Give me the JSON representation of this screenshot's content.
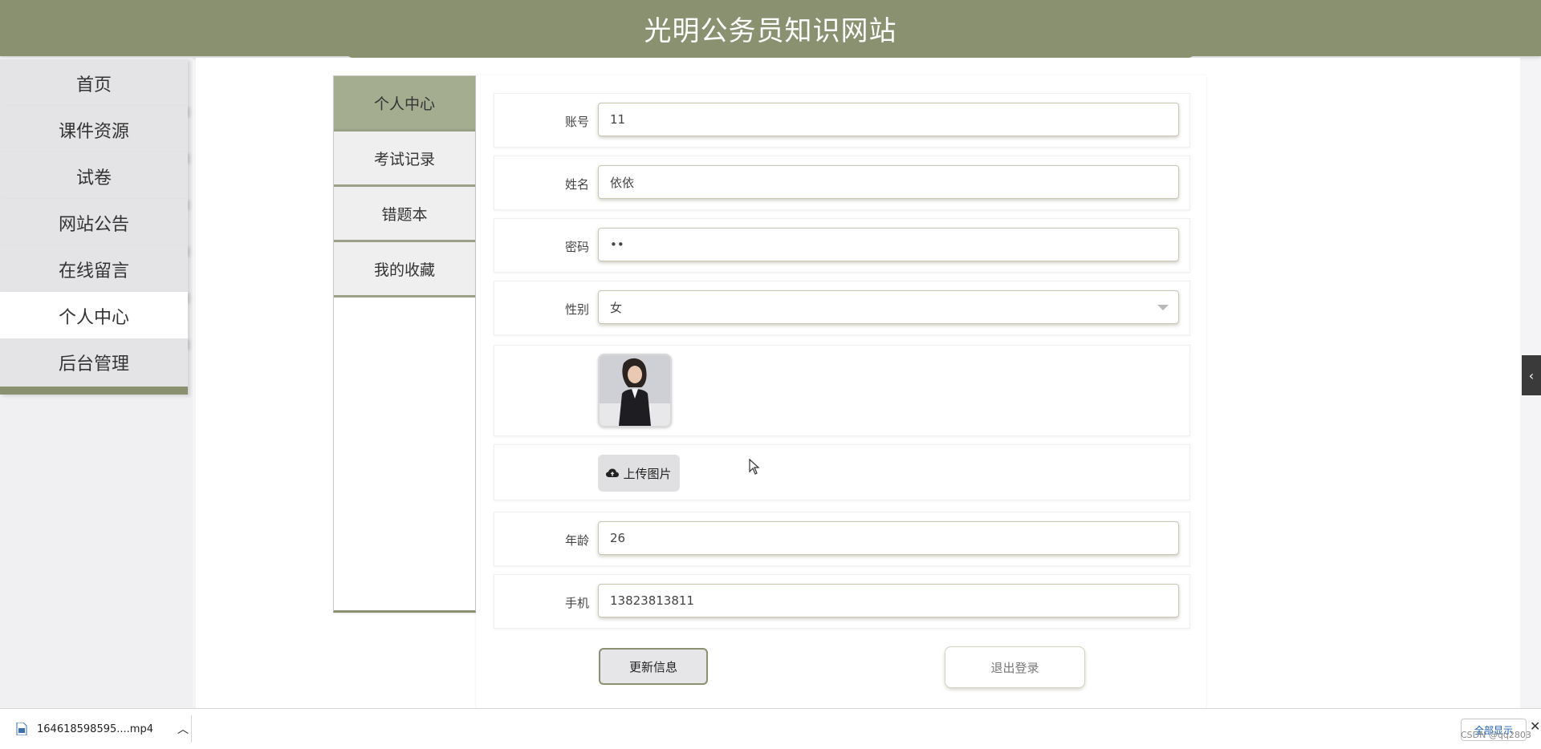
{
  "header": {
    "title": "光明公务员知识网站"
  },
  "nav": {
    "items": [
      {
        "label": "首页"
      },
      {
        "label": "课件资源"
      },
      {
        "label": "试卷"
      },
      {
        "label": "网站公告"
      },
      {
        "label": "在线留言"
      },
      {
        "label": "个人中心",
        "active": true
      },
      {
        "label": "后台管理"
      }
    ]
  },
  "subnav": {
    "items": [
      {
        "label": "个人中心",
        "active": true
      },
      {
        "label": "考试记录"
      },
      {
        "label": "错题本"
      },
      {
        "label": "我的收藏"
      }
    ]
  },
  "form": {
    "account": {
      "label": "账号",
      "value": "11"
    },
    "name": {
      "label": "姓名",
      "value": "依依"
    },
    "password": {
      "label": "密码",
      "value": "11"
    },
    "gender": {
      "label": "性别",
      "value": "女"
    },
    "upload_label": "上传图片",
    "age": {
      "label": "年龄",
      "value": "26"
    },
    "phone": {
      "label": "手机",
      "value": "13823813811"
    },
    "update_button": "更新信息",
    "logout_button": "退出登录"
  },
  "download_bar": {
    "file_name": "164618598595....mp4",
    "show_all": "全部显示"
  },
  "watermark": "CSDN @qq2803",
  "colors": {
    "accent": "#8a9170",
    "subnav_active": "#a5ad91",
    "nav_bg": "#e4e3e6"
  }
}
